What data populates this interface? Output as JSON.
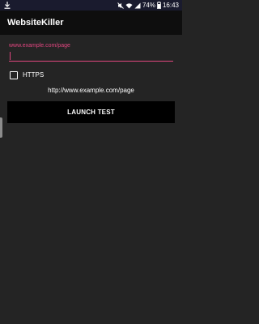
{
  "status_bar": {
    "battery": "74%",
    "time": "16:43",
    "icons": [
      "download-icon",
      "mute-icon",
      "wifi-icon",
      "signal-icon",
      "battery-icon"
    ]
  },
  "app_bar": {
    "title": "WebsiteKiller"
  },
  "form": {
    "url_hint": "www.example.com/page",
    "url_value": "",
    "https_label": "HTTPS",
    "https_checked": false,
    "resolved_url": "http://www.example.com/page",
    "launch_label": "LAUNCH TEST"
  },
  "colors": {
    "accent": "#e0467f",
    "background": "#242424",
    "app_bar": "#0e0e0e",
    "status_bar": "#1a1b2e",
    "button": "#000000"
  }
}
